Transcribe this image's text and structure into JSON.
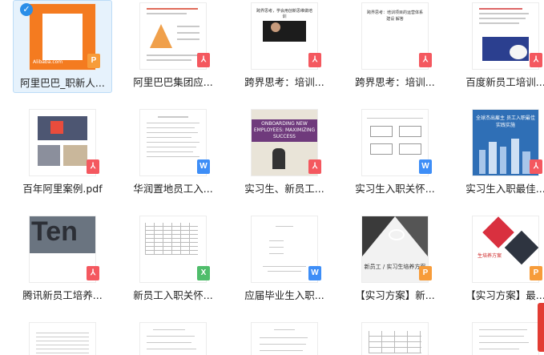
{
  "files": [
    {
      "name": "阿里巴巴_职新人...",
      "type": "ppt",
      "selected": true,
      "thumb_text": "Alibaba.com"
    },
    {
      "name": "阿里巴巴集团应...",
      "type": "pdf"
    },
    {
      "name": "跨界思考：培训...",
      "type": "pdf",
      "thumb_text": "跨界思考，学会用创新思维做培训"
    },
    {
      "name": "跨界思考：培训...",
      "type": "pdf",
      "thumb_text": "跨界思考：培训项目的运营体系建设 解答"
    },
    {
      "name": "百度新员工培训...",
      "type": "pdf"
    },
    {
      "name": "百年阿里案例.pdf",
      "type": "pdf"
    },
    {
      "name": "华润置地员工入...",
      "type": "doc"
    },
    {
      "name": "实习生、新员工...",
      "type": "pdf",
      "thumb_text": "ONBOARDING NEW EMPLOYEES: MAXIMIZING SUCCESS"
    },
    {
      "name": "实习生入职关怀...",
      "type": "doc"
    },
    {
      "name": "实习生入职最佳...",
      "type": "pdf",
      "thumb_text": "全球杰出雇主 员工入职最佳实践实施"
    },
    {
      "name": "腾讯新员工培养...",
      "type": "pdf",
      "thumb_text": "Ten"
    },
    {
      "name": "新员工入职关怀...",
      "type": "xls"
    },
    {
      "name": "应届毕业生入职...",
      "type": "doc"
    },
    {
      "name": "【实习方案】新...",
      "type": "ppt",
      "thumb_text": "新员工 / 实习生培养方案"
    },
    {
      "name": "【实习方案】最...",
      "type": "ppt",
      "thumb_text": "生培养方案"
    }
  ],
  "badges": {
    "pdf": "⅄",
    "ppt": "P",
    "doc": "W",
    "xls": "X"
  },
  "colors": {
    "accent": "#2a8ee8",
    "pdf": "#f4585f",
    "ppt": "#f79c3a",
    "doc": "#3e8ef7",
    "xls": "#4fbd6b"
  }
}
